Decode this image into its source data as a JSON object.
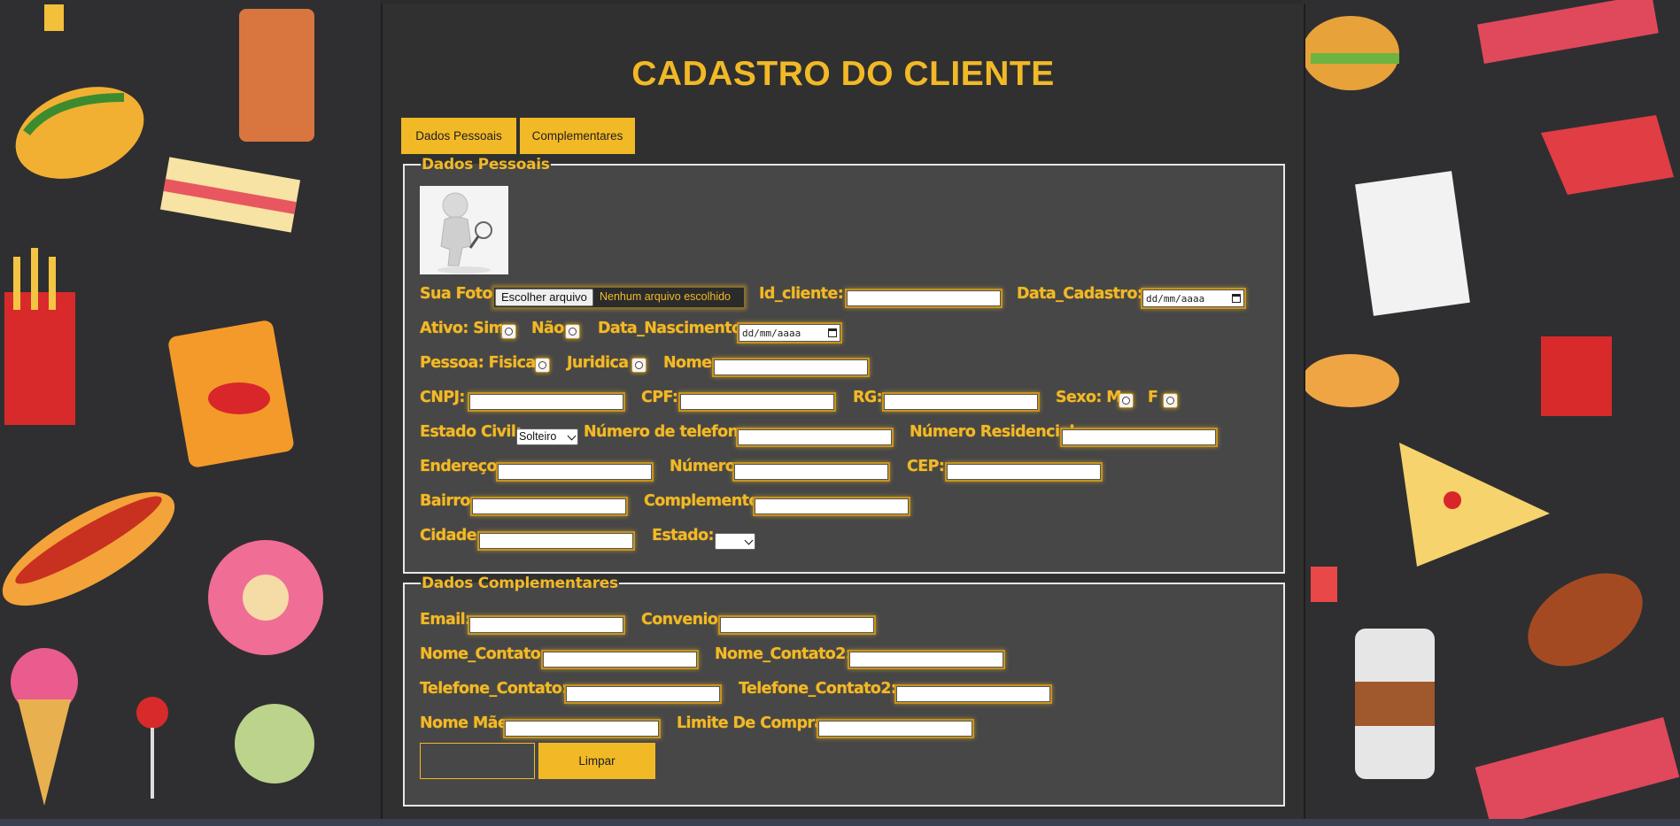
{
  "title": "CADASTRO DO CLIENTE",
  "tabs": [
    "Dados Pessoais",
    "Complementares"
  ],
  "colors": {
    "accent": "#f2b927",
    "panel": "#303030",
    "fieldset": "#474747",
    "background": "#2f2f31"
  },
  "personal": {
    "legend": "Dados Pessoais",
    "photo_label": "Sua Foto:",
    "file_button": "Escolher arquivo",
    "file_status": "Nenhum arquivo escolhido",
    "id_label": "Id_cliente:",
    "data_cadastro_label": "Data_Cadastro:",
    "date_placeholder": "dd/mm/aaaa",
    "ativo_label": "Ativo: Sim",
    "nao_label": "Não",
    "nascimento_label": "Data_Nascimento",
    "pessoa_label": "Pessoa: Fisica",
    "juridica_label": "Juridica",
    "nome_label": "Nome:",
    "cnpj_label": "CNPJ:",
    "cpf_label": "CPF:",
    "rg_label": "RG:",
    "sexo_label": "Sexo: M",
    "f_label": "F",
    "estado_civil_label": "Estado Civil:",
    "estado_civil_value": "Solteiro",
    "telefone_label": "Número de telefone:",
    "residencial_label": "Número Residencial",
    "endereco_label": "Endereço:",
    "numero_label": "Número:",
    "cep_label": "CEP:",
    "bairro_label": "Bairro:",
    "complemento_label": "Complemento:",
    "cidade_label": "Cidade:",
    "estado_label": "Estado:",
    "estado_value": ""
  },
  "complementary": {
    "legend": "Dados Complementares",
    "email_label": "Email:",
    "convenio_label": "Convenio:",
    "nome_contato_label": "Nome_Contato:",
    "nome_contato2_label": "Nome_Contato2:",
    "telefone_contato_label": "Telefone_Contato:",
    "telefone_contato2_label": "Telefone_Contato2:",
    "nome_mae_label": "Nome Mãe:",
    "limite_label": "Limite De Compra:",
    "submit_label": "",
    "clear_label": "Limpar"
  }
}
